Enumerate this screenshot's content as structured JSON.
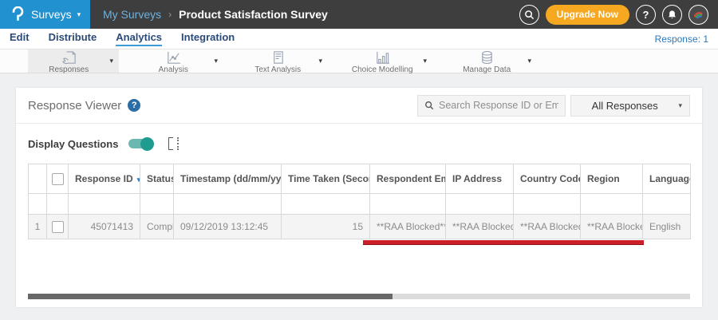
{
  "topbar": {
    "app_menu_label": "Surveys",
    "breadcrumb": {
      "parent": "My Surveys",
      "separator": "›",
      "current": "Product Satisfaction Survey"
    },
    "upgrade_label": "Upgrade Now",
    "help_glyph": "?"
  },
  "tabs": {
    "items": [
      {
        "label": "Edit"
      },
      {
        "label": "Distribute"
      },
      {
        "label": "Analytics"
      },
      {
        "label": "Integration"
      }
    ],
    "active": "Analytics",
    "response_count": "Response: 1"
  },
  "toolbar": {
    "groups": [
      {
        "label": "Responses",
        "selected": true
      },
      {
        "label": "Analysis",
        "selected": false
      },
      {
        "label": "Text Analysis",
        "selected": false
      },
      {
        "label": "Choice Modelling",
        "selected": false
      },
      {
        "label": "Manage Data",
        "selected": false
      }
    ]
  },
  "panel": {
    "title": "Response Viewer",
    "help_glyph": "?",
    "search_placeholder": "Search Response ID or Email",
    "filter_dropdown_value": "All Responses",
    "display_questions_label": "Display Questions",
    "toggle_on": true
  },
  "icons": {
    "caret_down": "▾",
    "sort_both": "⇅"
  },
  "table": {
    "columns": [
      {
        "label": ""
      },
      {
        "label": "",
        "type": "checkbox"
      },
      {
        "label": "Response ID",
        "sort": "desc"
      },
      {
        "label": "Status"
      },
      {
        "label": "Timestamp (dd/mm/yyyy)",
        "sort": "both"
      },
      {
        "label": "Time Taken (Seconds)",
        "sort": "both"
      },
      {
        "label": "Respondent Email"
      },
      {
        "label": "IP Address"
      },
      {
        "label": "Country Code"
      },
      {
        "label": "Region"
      },
      {
        "label": "Language"
      }
    ],
    "rows": [
      {
        "index": "1",
        "response_id": "45071413",
        "status": "Completed",
        "timestamp": "09/12/2019 13:12:45",
        "time_taken": "15",
        "respondent_email": "**RAA Blocked**",
        "ip_address": "**RAA Blocked**",
        "country_code": "**RAA Blocked**",
        "region": "**RAA Blocked**",
        "language": "English"
      }
    ]
  },
  "annotation": {
    "type": "red-underline",
    "color": "#cb2027"
  },
  "colors": {
    "brand_blue": "#2191d0",
    "navy": "#2b4a78",
    "orange": "#f6a820",
    "teal": "#1d9c8f",
    "link_blue": "#3c7cc1",
    "annotation_red": "#cb2027"
  }
}
